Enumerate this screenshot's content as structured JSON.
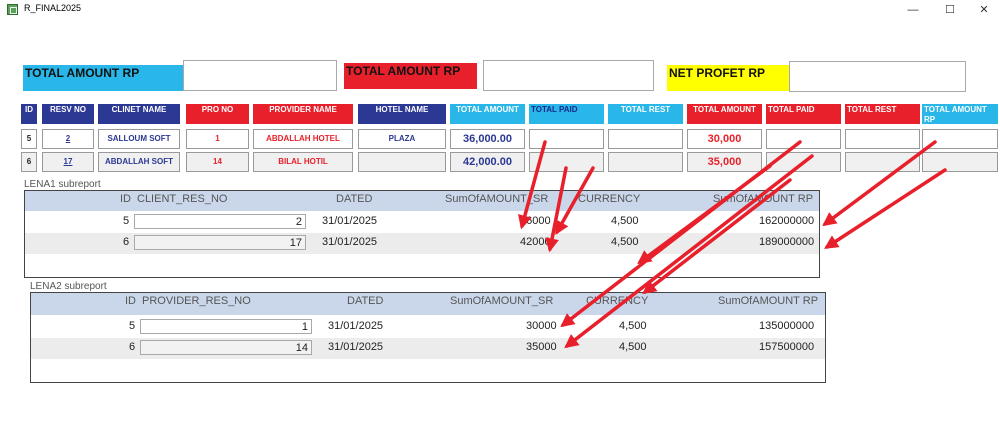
{
  "window": {
    "title": "R_FINAL2025",
    "minimize": "—",
    "maximize": "☐",
    "close": "✕"
  },
  "summary": {
    "client_total_label": "TOTAL AMOUNT RP",
    "provider_total_label": "TOTAL AMOUNT RP",
    "net_profit_label": "NET PROFET RP",
    "colors": {
      "cyan": "#29b6e8",
      "red": "#e8202b",
      "yellow": "#ffff00"
    }
  },
  "table": {
    "headers": [
      "ID",
      "RESV NO",
      "CLINET NAME",
      "PRO NO",
      "PROVIDER NAME",
      "HOTEL NAME",
      "TOTAL AMOUNT",
      "TOTAL PAID",
      "TOTAL REST",
      "TOTAL AMOUNT",
      "TOTAL PAID",
      "TOTAL REST",
      "TOTAL AMOUNT RP"
    ],
    "rows": [
      {
        "id": "5",
        "resv_no": "2",
        "client_name": "SALLOUM SOFT",
        "pro_no": "1",
        "provider_name": "ABDALLAH HOTEL",
        "hotel_name": "PLAZA",
        "total_amount": "36,000.00",
        "provider_total_amount": "30,000"
      },
      {
        "id": "6",
        "resv_no": "17",
        "client_name": "ABDALLAH SOFT",
        "pro_no": "14",
        "provider_name": "BILAL HOTIL",
        "hotel_name": "",
        "total_amount": "42,000.00",
        "provider_total_amount": "35,000"
      }
    ]
  },
  "lena1": {
    "caption": "LENA1 subreport",
    "columns": [
      "ID",
      "CLIENT_RES_NO",
      "DATED",
      "SumOfAMOUNT_SR",
      "CURRENCY",
      "SumOfAMOUNT RP"
    ],
    "rows": [
      {
        "id": "5",
        "res_no": "2",
        "dated": "31/01/2025",
        "amount_sr": "36000",
        "currency": "4,500",
        "amount_rp": "162000000"
      },
      {
        "id": "6",
        "res_no": "17",
        "dated": "31/01/2025",
        "amount_sr": "42000",
        "currency": "4,500",
        "amount_rp": "189000000"
      }
    ]
  },
  "lena2": {
    "caption": "LENA2 subreport",
    "columns": [
      "ID",
      "PROVIDER_RES_NO",
      "DATED",
      "SumOfAMOUNT_SR",
      "CURRENCY",
      "SumOfAMOUNT RP"
    ],
    "rows": [
      {
        "id": "5",
        "res_no": "1",
        "dated": "31/01/2025",
        "amount_sr": "30000",
        "currency": "4,500",
        "amount_rp": "135000000"
      },
      {
        "id": "6",
        "res_no": "14",
        "dated": "31/01/2025",
        "amount_sr": "35000",
        "currency": "4,500",
        "amount_rp": "157500000"
      }
    ]
  },
  "annotation": {
    "arrow_color": "#e8202b",
    "arrow_count": 9
  }
}
